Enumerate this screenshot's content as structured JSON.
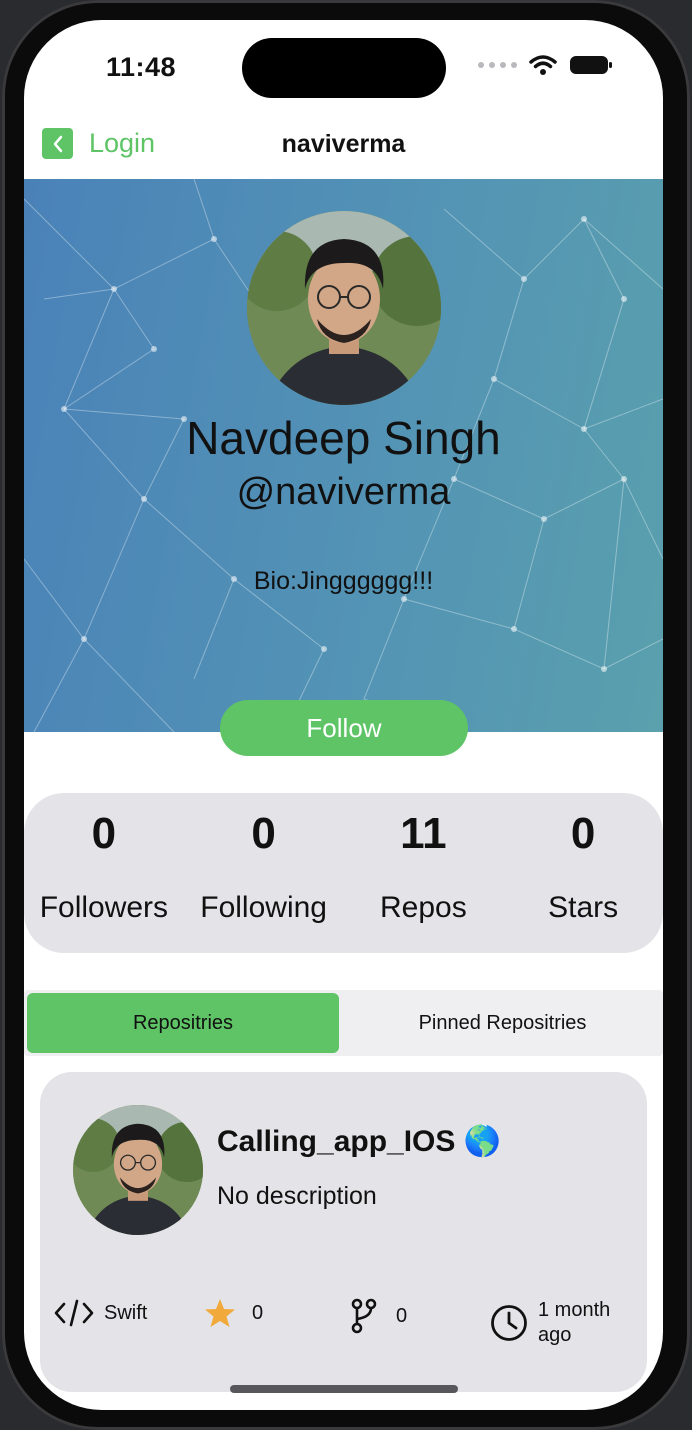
{
  "status_bar": {
    "time": "11:48"
  },
  "nav": {
    "back_label": "Login",
    "title": "naviverma"
  },
  "profile": {
    "name": "Navdeep Singh",
    "handle": "@naviverma",
    "bio": "Bio:Jingggggg!!!",
    "follow_label": "Follow"
  },
  "stats": [
    {
      "value": "0",
      "label": "Followers"
    },
    {
      "value": "0",
      "label": "Following"
    },
    {
      "value": "11",
      "label": "Repos"
    },
    {
      "value": "0",
      "label": "Stars"
    }
  ],
  "tabs": [
    {
      "label": "Repositries",
      "active": true
    },
    {
      "label": "Pinned Repositries",
      "active": false
    }
  ],
  "repos": [
    {
      "name": "Calling_app_IOS",
      "emoji": "🌎",
      "description": "No description",
      "language": "Swift",
      "stars": "0",
      "forks": "0",
      "updated_line1": "1 month",
      "updated_line2": "ago"
    }
  ],
  "colors": {
    "accent": "#5ec466",
    "card": "#e4e4e8",
    "banner": "#4f8cb6",
    "star": "#f0a93a"
  },
  "icons": [
    "back-chevron-icon",
    "signal-dots-icon",
    "wifi-icon",
    "battery-icon",
    "code-icon",
    "star-icon",
    "fork-icon",
    "clock-icon"
  ]
}
